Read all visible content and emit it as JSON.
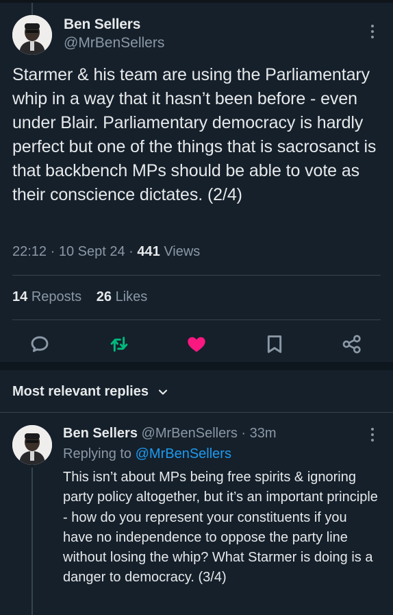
{
  "tweet": {
    "author_name": "Ben Sellers",
    "author_handle": "@MrBenSellers",
    "text": "Starmer & his team are using the Parliamentary whip in a way that it hasn’t been before - even under Blair. Parliamentary democracy is hardly perfect but one of the things that is sacrosanct is that backbench MPs should be able to vote as their conscience dictates. (2/4)",
    "time": "22:12",
    "date": "10 Sept 24",
    "views_count": "441",
    "views_label": "Views",
    "reposts_count": "14",
    "reposts_label": "Reposts",
    "likes_count": "26",
    "likes_label": "Likes"
  },
  "actions": [
    {
      "name": "reply",
      "icon": "reply-icon"
    },
    {
      "name": "repost",
      "icon": "repost-icon",
      "color": "#00ba7c"
    },
    {
      "name": "like",
      "icon": "heart-icon",
      "color": "#f91880"
    },
    {
      "name": "bookmark",
      "icon": "bookmark-icon"
    },
    {
      "name": "share",
      "icon": "share-icon"
    }
  ],
  "replies_header": {
    "label": "Most relevant replies"
  },
  "reply": {
    "author_name": "Ben Sellers",
    "author_handle": "@MrBenSellers",
    "time_ago": "33m",
    "replying_to_label": "Replying to",
    "replying_to_handle": "@MrBenSellers",
    "text": "This isn’t about MPs being free spirits & ignoring party policy altogether, but it’s an important principle - how do you represent your constituents if you have no independence to oppose the party line without losing the whip? What Starmer is doing is a danger to democracy. (3/4)"
  },
  "colors": {
    "background": "#15202b",
    "text_primary": "#e7e9ea",
    "text_secondary": "#8b98a5",
    "link": "#1d9bf0",
    "repost": "#00ba7c",
    "like": "#f91880"
  }
}
